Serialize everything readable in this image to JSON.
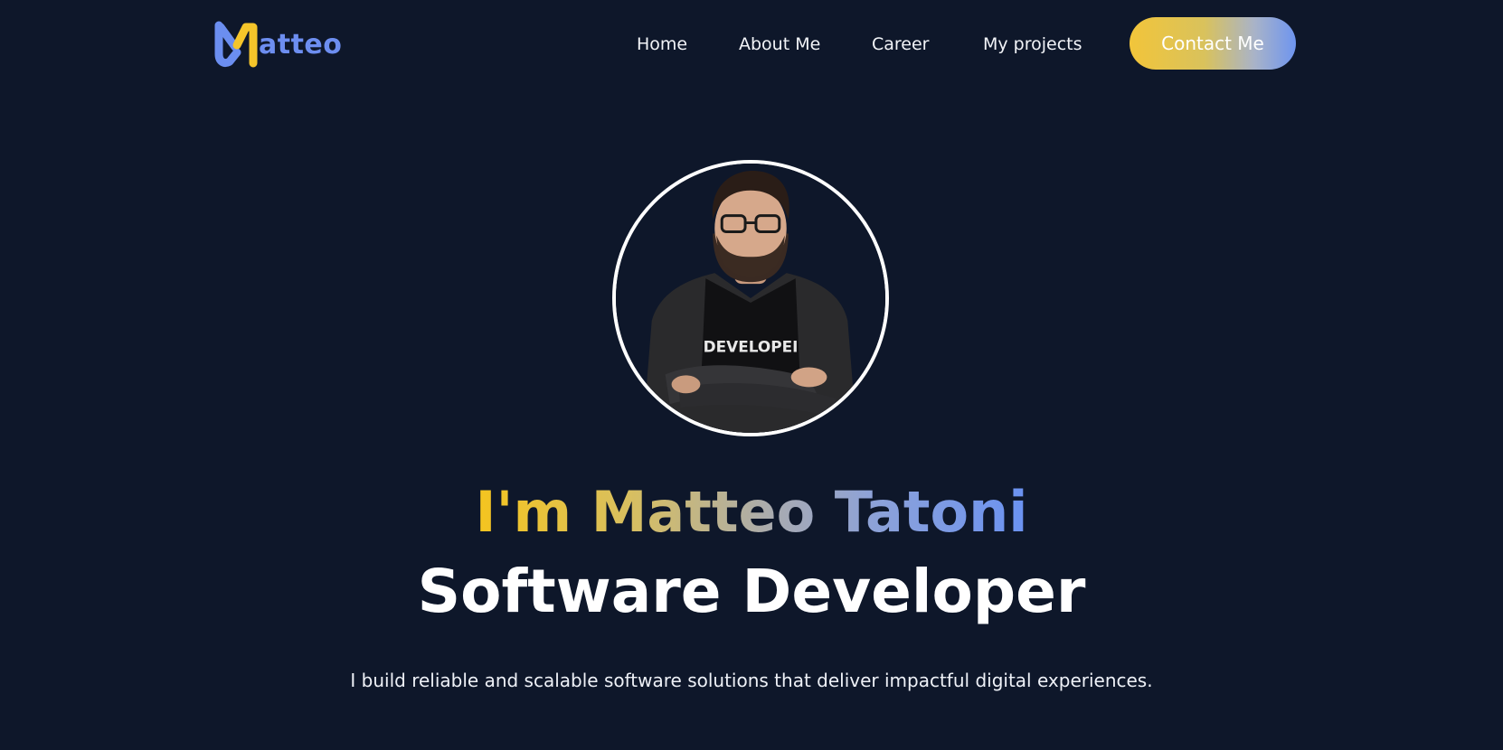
{
  "header": {
    "logo_text": "atteo",
    "logo_colors": {
      "blue": "#6b8ef0",
      "yellow": "#f5c52a"
    },
    "nav": {
      "home": "Home",
      "about": "About Me",
      "career": "Career",
      "projects": "My projects"
    },
    "contact_label": "Contact Me"
  },
  "hero": {
    "avatar_alt": "Portrait of Matteo Tatoni",
    "shirt_text": "DEVELOPEI",
    "headline": "I'm Matteo Tatoni",
    "role": "Software Developer",
    "tagline": "I build reliable and scalable software solutions that deliver impactful digital experiences."
  },
  "theme": {
    "background": "#0e172a",
    "accent_yellow": "#f5c51e",
    "accent_blue": "#6a92f2",
    "text": "#ffffff"
  }
}
